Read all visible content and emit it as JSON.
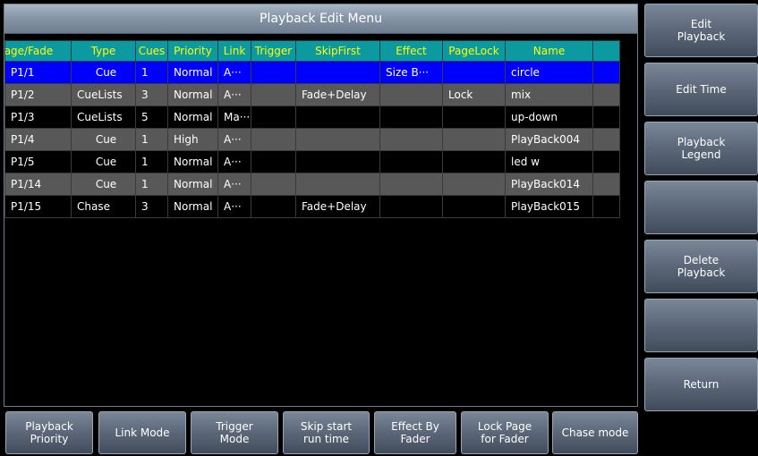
{
  "title": "Playback Edit Menu",
  "columns": [
    "Page/Fade",
    "Type",
    "Cues",
    "Priority",
    "Link",
    "Trigger",
    "SkipFirst",
    "Effect",
    "PageLock",
    "Name"
  ],
  "rows": [
    {
      "page": "P1/1",
      "type": "Cue",
      "cues": "1",
      "priority": "Normal",
      "link": "A···",
      "trigger": "",
      "skip": "",
      "effect": "Size B···",
      "lock": "",
      "name": "circle"
    },
    {
      "page": "P1/2",
      "type": "CueLists",
      "cues": "3",
      "priority": "Normal",
      "link": "A···",
      "trigger": "",
      "skip": "Fade+Delay",
      "effect": "",
      "lock": "Lock",
      "name": "mix"
    },
    {
      "page": "P1/3",
      "type": "CueLists",
      "cues": "5",
      "priority": "Normal",
      "link": "Ma···",
      "trigger": "",
      "skip": "",
      "effect": "",
      "lock": "",
      "name": "up-down"
    },
    {
      "page": "P1/4",
      "type": "Cue",
      "cues": "1",
      "priority": "High",
      "link": "A···",
      "trigger": "",
      "skip": "",
      "effect": "",
      "lock": "",
      "name": "PlayBack004"
    },
    {
      "page": "P1/5",
      "type": "Cue",
      "cues": "1",
      "priority": "Normal",
      "link": "A···",
      "trigger": "",
      "skip": "",
      "effect": "",
      "lock": "",
      "name": "led w"
    },
    {
      "page": "P1/14",
      "type": "Cue",
      "cues": "1",
      "priority": "Normal",
      "link": "A···",
      "trigger": "",
      "skip": "",
      "effect": "",
      "lock": "",
      "name": "PlayBack014"
    },
    {
      "page": "P1/15",
      "type": "Chase",
      "cues": "3",
      "priority": "Normal",
      "link": "A···",
      "trigger": "",
      "skip": "Fade+Delay",
      "effect": "",
      "lock": "",
      "name": "PlayBack015"
    }
  ],
  "side_buttons": [
    {
      "label": "Edit\nPlayback"
    },
    {
      "label": "Edit Time"
    },
    {
      "label": "Playback\nLegend"
    },
    {
      "label": ""
    },
    {
      "label": "Delete\nPlayback"
    },
    {
      "label": ""
    },
    {
      "label": "Return"
    }
  ],
  "bottom_buttons": [
    {
      "label": "Playback\nPriority"
    },
    {
      "label": "Link Mode"
    },
    {
      "label": "Trigger\nMode"
    },
    {
      "label": "Skip start\nrun time"
    },
    {
      "label": "Effect By\nFader"
    },
    {
      "label": "Lock Page\nfor Fader"
    },
    {
      "label": "Chase mode"
    }
  ],
  "colors": {
    "header_bg": "#0c9aa0",
    "header_text": "#ffff00",
    "selected_row": "#0000ff",
    "alt_row": "#585858"
  }
}
